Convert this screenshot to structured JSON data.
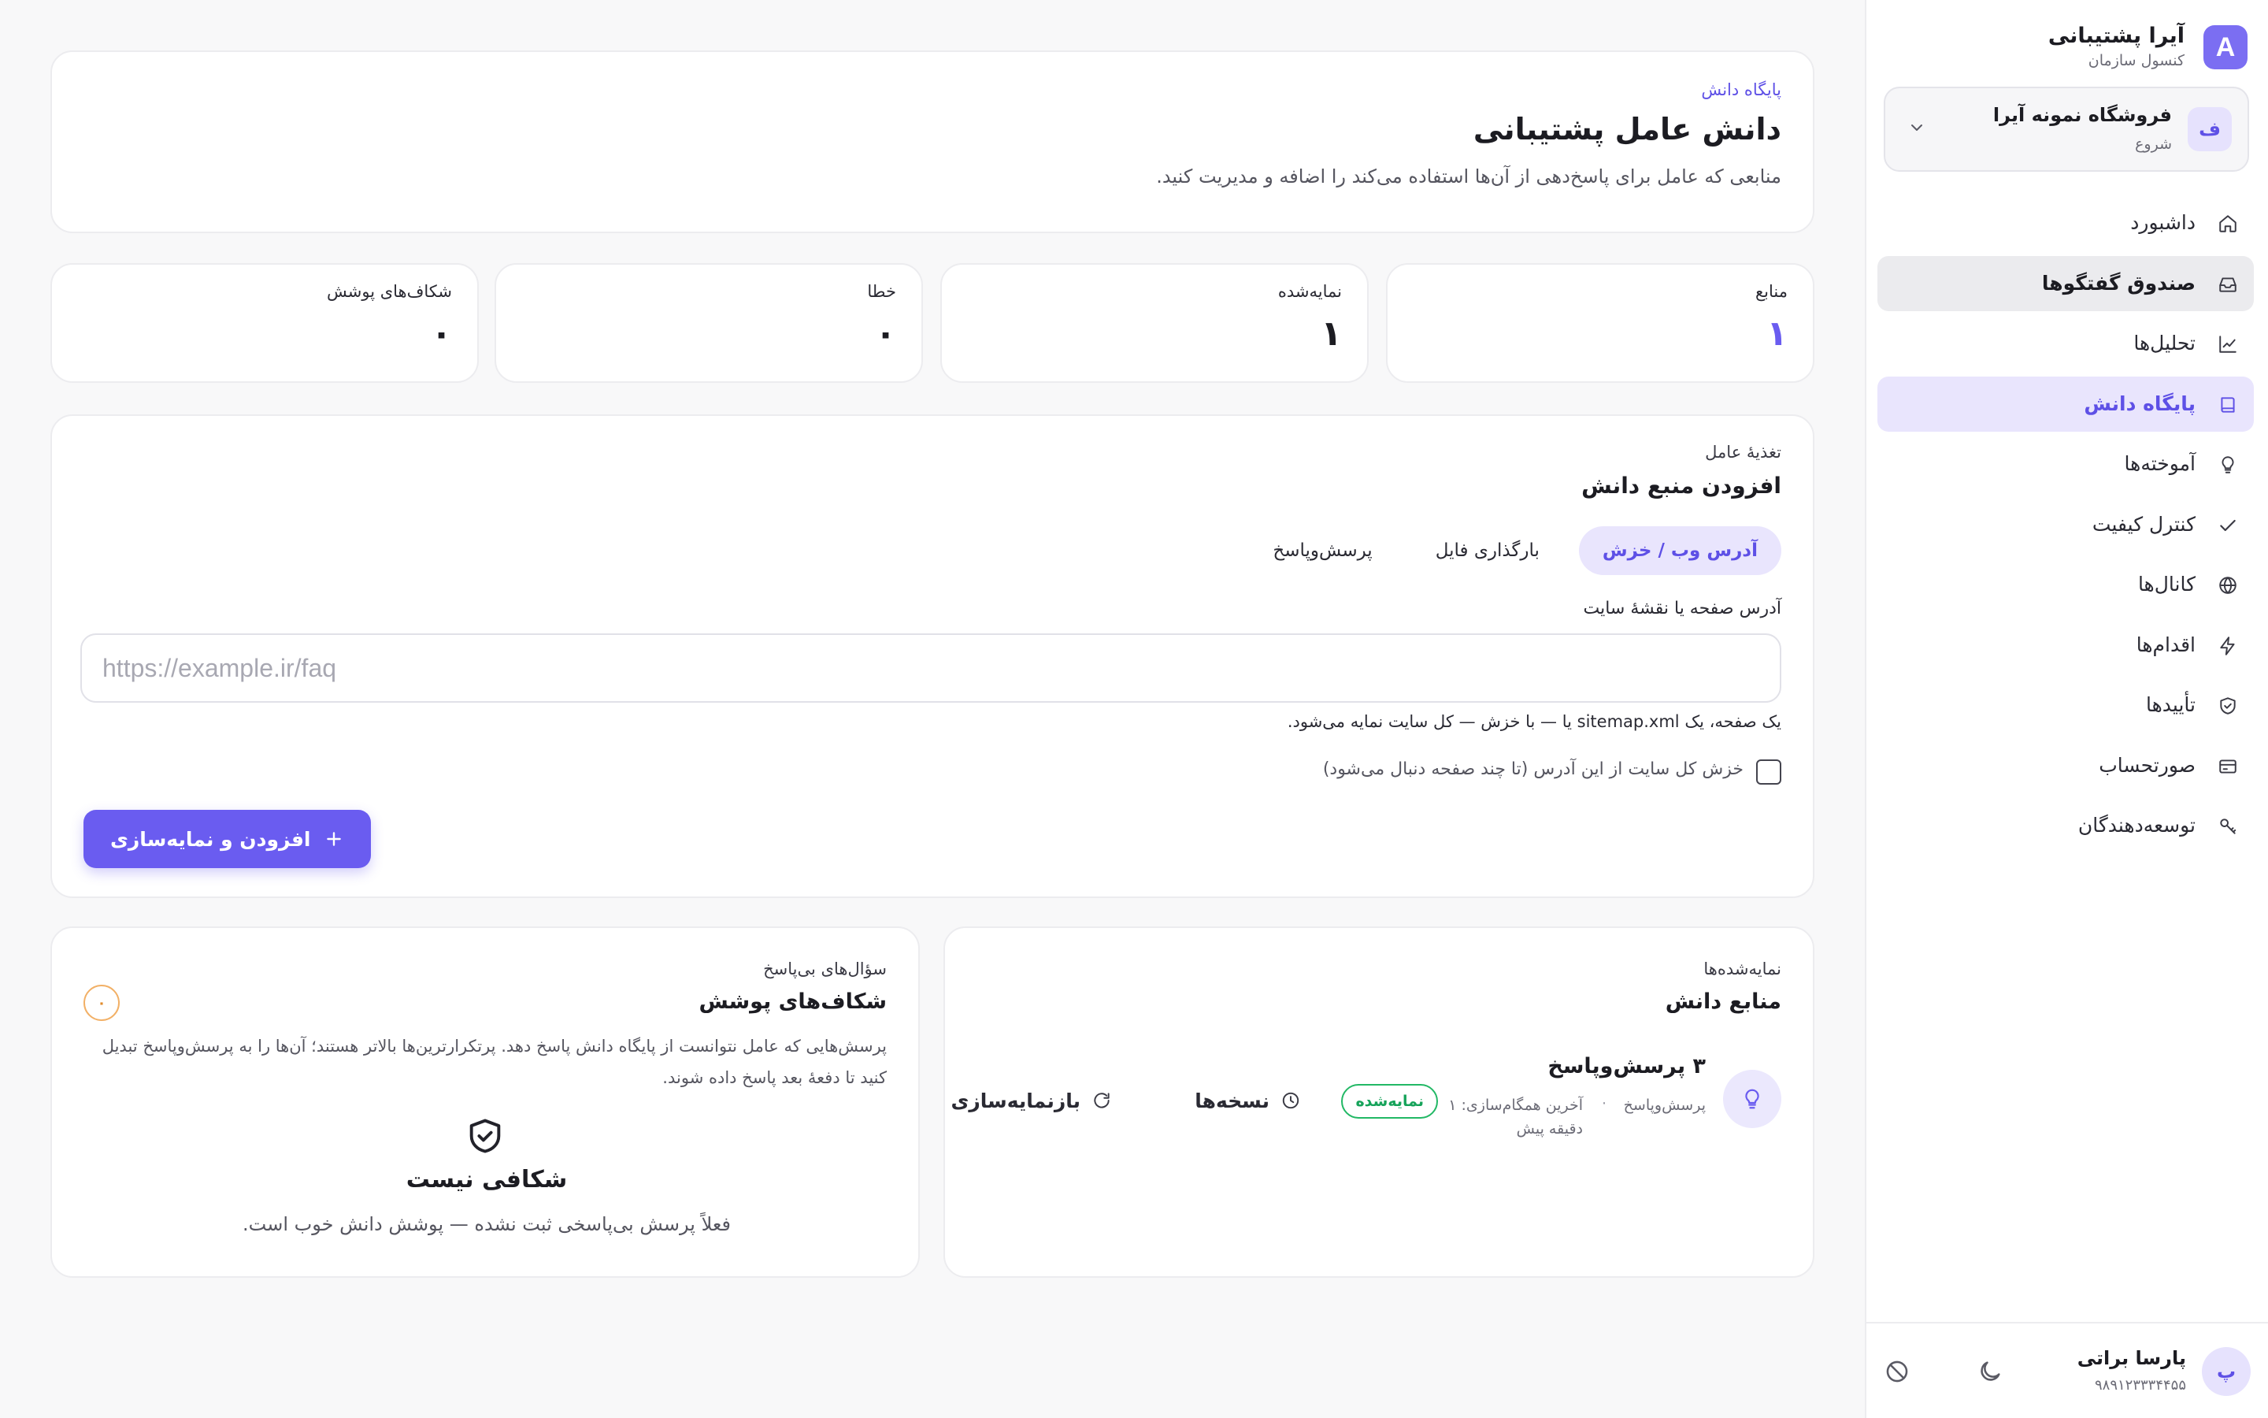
{
  "brand": {
    "logo": "A",
    "name": "آیرا پشتیبانی",
    "subtitle": "کنسول سازمان"
  },
  "org": {
    "avatar": "ف",
    "name": "فروشگاه نمونه آیرا",
    "plan": "شروع"
  },
  "nav": {
    "items": [
      {
        "label": "داشبورد",
        "icon": "home-icon"
      },
      {
        "label": "صندوق گفتگوها",
        "icon": "inbox-icon",
        "state": "hover"
      },
      {
        "label": "تحلیل‌ها",
        "icon": "chart-icon"
      },
      {
        "label": "پایگاه دانش",
        "icon": "book-icon",
        "state": "active"
      },
      {
        "label": "آموخته‌ها",
        "icon": "lightbulb-icon"
      },
      {
        "label": "کنترل کیفیت",
        "icon": "check-icon"
      },
      {
        "label": "کانال‌ها",
        "icon": "globe-icon"
      },
      {
        "label": "اقدام‌ها",
        "icon": "bolt-icon"
      },
      {
        "label": "تأییدها",
        "icon": "shield-icon"
      },
      {
        "label": "صورتحساب",
        "icon": "card-icon"
      },
      {
        "label": "توسعه‌دهندگان",
        "icon": "key-icon"
      }
    ]
  },
  "user": {
    "avatar": "پ",
    "name": "پارسا براتی",
    "phone": "۹۸۹۱۲۳۳۳۴۴۵۵"
  },
  "header": {
    "eyebrow": "پایگاه دانش",
    "title": "دانش عامل پشتیبانی",
    "description": "منابعی که عامل برای پاسخ‌دهی از آن‌ها استفاده می‌کند را اضافه و مدیریت کنید."
  },
  "stats": [
    {
      "label": "منابع",
      "value": "۱"
    },
    {
      "label": "نمایه‌شده",
      "value": "۱"
    },
    {
      "label": "خطا",
      "value": "۰"
    },
    {
      "label": "شکاف‌های پوشش",
      "value": "۰"
    }
  ],
  "add_source": {
    "eyebrow": "تغذیهٔ عامل",
    "title": "افزودن منبع دانش",
    "tabs": [
      "آدرس وب / خزش",
      "بارگذاری فایل",
      "پرسش‌وپاسخ"
    ],
    "field_label": "آدرس صفحه یا نقشهٔ سایت",
    "placeholder": "https://example.ir/faq",
    "hint": "یک صفحه، یک sitemap.xml یا — با خزش — کل سایت نمایه می‌شود.",
    "crawl_label": "خزش کل سایت از این آدرس (تا چند صفحه دنبال می‌شود)",
    "submit_label": "افزودن و نمایه‌سازی"
  },
  "sources": {
    "eyebrow": "نمایه‌شده‌ها",
    "title": "منابع دانش",
    "items": [
      {
        "title": "۳ پرسش‌وپاسخ",
        "type": "پرسش‌وپاسخ",
        "separator": "·",
        "sync": "آخرین همگام‌سازی: ۱ دقیقه پیش",
        "status": "نمایه‌شده",
        "versions_label": "نسخه‌ها",
        "reindex_label": "بازنمایه‌سازی"
      }
    ]
  },
  "gaps": {
    "eyebrow": "سؤال‌های بی‌پاسخ",
    "title": "شکاف‌های پوشش",
    "count": "۰",
    "description": "پرسش‌هایی که عامل نتوانست از پایگاه دانش پاسخ دهد. پرتکرارترین‌ها بالاتر هستند؛ آن‌ها را به پرسش‌وپاسخ تبدیل کنید تا دفعهٔ بعد پاسخ داده شوند.",
    "empty_title": "شکافی نیست",
    "empty_desc": "فعلاً پرسش بی‌پاسخی ثبت نشده — پوشش دانش خوب است."
  },
  "colors": {
    "accent": "#6a5cf0",
    "accent_soft": "#e9e5fd",
    "success": "#16a35a",
    "warning": "#e08a2a"
  }
}
